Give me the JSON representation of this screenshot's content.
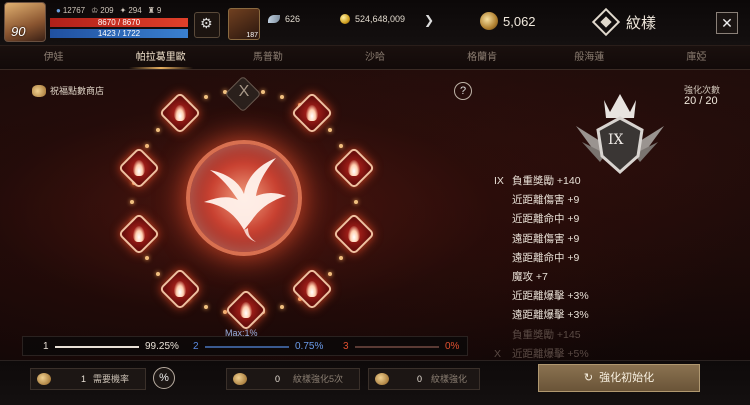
{
  "player": {
    "level": "90",
    "stat_a": "209",
    "stat_b": "294",
    "stat_c": "9",
    "stat_0": "12767",
    "hp": "8670 / 8670",
    "mp": "1423 / 1722"
  },
  "slots": {
    "slot2_count": "187"
  },
  "currency": {
    "feather": "626",
    "gold": "524,648,009",
    "crest": "5,062"
  },
  "header": {
    "title": "紋樣",
    "close": "✕"
  },
  "tabs": [
    "伊娃",
    "帕拉葛里歐",
    "馬普勒",
    "沙哈",
    "格蘭肯",
    "般海蓮",
    "庫婭"
  ],
  "active_tab": 1,
  "shop_label": "祝福點數商店",
  "help_label": "?",
  "locked_node_label": "X",
  "enhance": {
    "label": "強化次數",
    "value": "20 / 20",
    "rank": "IX"
  },
  "stats": [
    {
      "rank": "IX",
      "text": "負重獎勵 +140",
      "dim": false
    },
    {
      "rank": "",
      "text": "近距離傷害 +9",
      "dim": false
    },
    {
      "rank": "",
      "text": "近距離命中 +9",
      "dim": false
    },
    {
      "rank": "",
      "text": "遠距離傷害 +9",
      "dim": false
    },
    {
      "rank": "",
      "text": "遠距離命中 +9",
      "dim": false
    },
    {
      "rank": "",
      "text": "魔攻 +7",
      "dim": false
    },
    {
      "rank": "",
      "text": "近距離爆擊 +3%",
      "dim": false
    },
    {
      "rank": "",
      "text": "遠距離爆擊 +3%",
      "dim": false
    },
    {
      "rank": "",
      "text": "負重獎勵 +145",
      "dim": true
    },
    {
      "rank": "X",
      "text": "近距離爆擊 +5%",
      "dim": true
    }
  ],
  "probability": {
    "max_label": "Max:1%",
    "t1": {
      "num": "1",
      "pct": "99.25%"
    },
    "t2": {
      "num": "2",
      "pct": "0.75%"
    },
    "t3": {
      "num": "3",
      "pct": "0%"
    }
  },
  "bottom": {
    "needed_value": "1",
    "needed_label": "需要機率",
    "pct_btn": "%",
    "f1_value": "0",
    "f1_label": "紋樣強化5次",
    "f2_value": "0",
    "f2_label": "紋樣強化",
    "reset_label": "強化初始化",
    "reset_icon": "↻"
  },
  "colors": {
    "accent": "#e8b060",
    "node_red": "#c02820",
    "tier1": "#e8e0d6",
    "tier2": "#5a8ae0",
    "tier3": "#e05030"
  },
  "icons": [
    "level-badge",
    "feather-icon",
    "gold-coin-icon",
    "crest-coin-icon",
    "pattern-title-icon",
    "close-icon",
    "help-icon",
    "flame-node-icon",
    "phoenix-emblem",
    "rank-emblem-icon",
    "percent-icon",
    "reset-icon"
  ]
}
